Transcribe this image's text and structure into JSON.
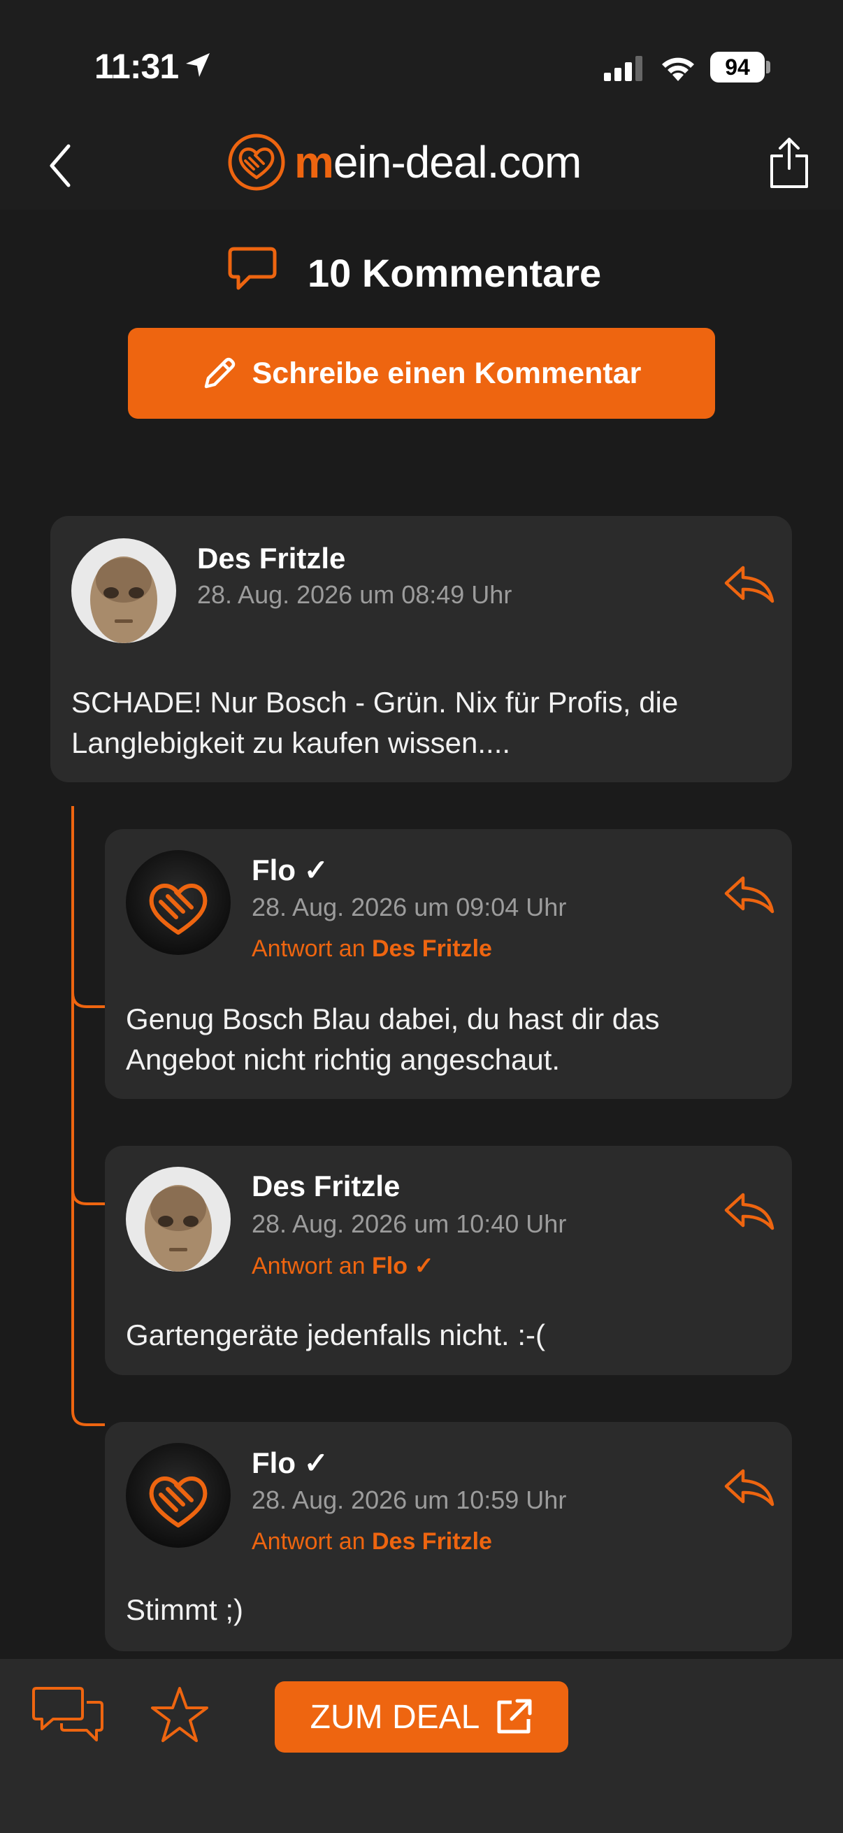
{
  "status": {
    "time": "11:31",
    "battery": "94"
  },
  "header": {
    "logo_m": "m",
    "logo_rest": "ein-deal.com"
  },
  "comments_header": {
    "title": "10 Kommentare"
  },
  "write_button": {
    "label": "Schreibe einen Kommentar"
  },
  "comments": [
    {
      "author": "Des Fritzle",
      "date": "28. Aug. 2026 um 08:49 Uhr",
      "body_lines": [
        "SCHADE! Nur Bosch - Grün. Nix für Profis, die",
        "Langlebigkeit zu kaufen wissen...."
      ]
    },
    {
      "author": "Flo ✓",
      "date": "28. Aug. 2026 um 09:04 Uhr",
      "reply_prefix": "Antwort an ",
      "reply_to": "Des Fritzle",
      "body_lines": [
        "Genug Bosch Blau dabei, du hast dir das",
        "Angebot nicht richtig angeschaut."
      ]
    },
    {
      "author": "Des Fritzle",
      "date": "28. Aug. 2026 um 10:40 Uhr",
      "reply_prefix": "Antwort an ",
      "reply_to": "Flo ✓",
      "body_lines": [
        "Gartengeräte jedenfalls nicht. :-("
      ]
    },
    {
      "author": "Flo ✓",
      "date": "28. Aug. 2026 um 10:59 Uhr",
      "reply_prefix": "Antwort an ",
      "reply_to": "Des Fritzle",
      "body_lines": [
        "Stimmt ;)"
      ]
    }
  ],
  "bottom_bar": {
    "deal_label": "ZUM DEAL"
  },
  "colors": {
    "accent": "#ee6510",
    "card": "#2b2b2b",
    "background": "#1b1b1b"
  },
  "icons": [
    "location-arrow-icon",
    "signal-icon",
    "wifi-icon",
    "battery-icon",
    "back-chevron-icon",
    "handshake-heart-logo-icon",
    "share-icon",
    "speech-bubble-icon",
    "pencil-icon",
    "reply-arrow-icon",
    "comments-icon",
    "star-icon",
    "external-link-icon"
  ]
}
